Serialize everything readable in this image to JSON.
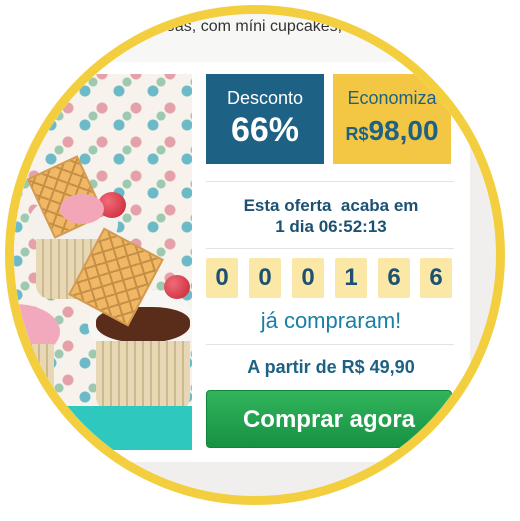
{
  "header": {
    "description_fragment": "ssoas, com míni cupcakes,"
  },
  "deal": {
    "discount_label": "Desconto",
    "discount_value": "66%",
    "savings_label": "Economiza",
    "savings_currency": "R$",
    "savings_value": "98,00",
    "offer_ends_label": "Esta oferta  acaba em",
    "countdown": "1 dia 06:52:13",
    "counter_digits": [
      "0",
      "0",
      "0",
      "1",
      "6",
      "6"
    ],
    "bought_label": "já compraram!",
    "price_label": "A partir de R$ 49,90",
    "buy_button": "Comprar agora"
  },
  "colors": {
    "frame": "#f3cf3f",
    "discount_tile": "#1d6185",
    "savings_tile": "#f3c743",
    "digit_tile": "#fbe7a6",
    "buy_button": "#22a34f",
    "teal_strip": "#2fc8bf"
  }
}
